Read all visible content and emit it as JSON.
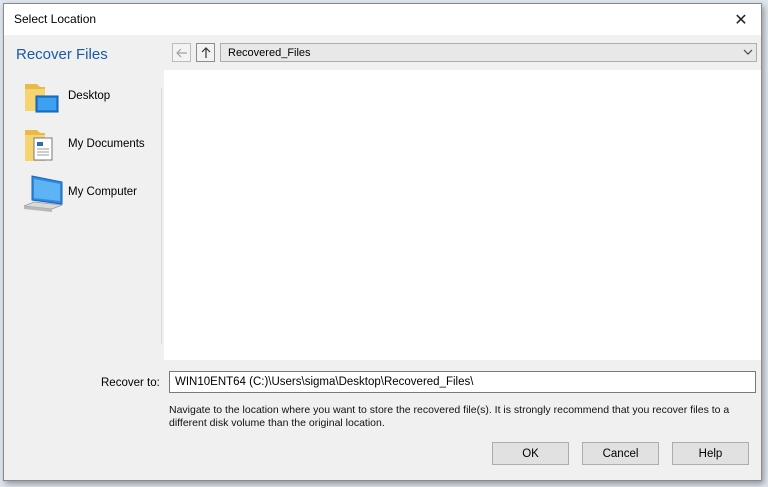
{
  "window": {
    "title": "Select Location",
    "close_symbol": "✕"
  },
  "header": {
    "label": "Recover Files"
  },
  "nav": {
    "back_icon": "arrow-left-icon",
    "up_icon": "arrow-up-icon",
    "path": "Recovered_Files",
    "dropdown_icon": "chevron-down-icon"
  },
  "sidebar": {
    "items": [
      {
        "label": "Desktop",
        "icon": "desktop-folder-icon"
      },
      {
        "label": "My Documents",
        "icon": "documents-folder-icon"
      },
      {
        "label": "My Computer",
        "icon": "computer-icon"
      }
    ]
  },
  "recover": {
    "label": "Recover to:",
    "value": "WIN10ENT64 (C:)\\Users\\sigma\\Desktop\\Recovered_Files\\",
    "hint": "Navigate to the location where you want to store the recovered file(s). It is strongly recommend that you recover files to a different disk volume than the original location."
  },
  "buttons": {
    "ok": "OK",
    "cancel": "Cancel",
    "help": "Help"
  }
}
